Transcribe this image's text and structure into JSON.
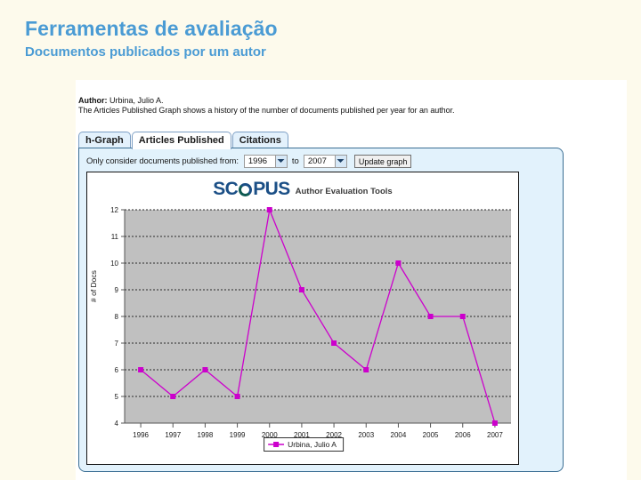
{
  "slide": {
    "title": "Ferramentas de avaliação",
    "subtitle": "Documentos publicados por um autor",
    "title_color": "#4a9bd4"
  },
  "capture": {
    "author_label": "Author:",
    "author_name": "Urbina, Julio A.",
    "description": "The Articles Published Graph shows a history of the number of documents published per year for an author.",
    "tabs": [
      {
        "label": "h-Graph",
        "active": false
      },
      {
        "label": "Articles Published",
        "active": true
      },
      {
        "label": "Citations",
        "active": false
      }
    ],
    "filter": {
      "label": "Only consider documents published from:",
      "from_value": "1996",
      "to_label": "to",
      "to_value": "2007",
      "update_button": "Update graph"
    },
    "logo": {
      "brand_prefix": "SC",
      "brand_suffix": "PUS",
      "tagline": "Author Evaluation Tools",
      "brand_color": "#1b4f86"
    }
  },
  "chart_data": {
    "type": "line",
    "title": "",
    "xlabel": "",
    "ylabel": "# of Docs",
    "categories": [
      "1996",
      "1997",
      "1998",
      "1999",
      "2000",
      "2001",
      "2002",
      "2003",
      "2004",
      "2005",
      "2006",
      "2007"
    ],
    "yticks": [
      12,
      11,
      10,
      9,
      8,
      7,
      6,
      5,
      4
    ],
    "ylim": [
      4,
      12
    ],
    "grid": true,
    "legend_position": "bottom-center",
    "plot_bgcolor": "#c0c0c0",
    "series": [
      {
        "name": "Urbina, Julio A",
        "color": "#cc00cc",
        "values": [
          6,
          5,
          6,
          5,
          12,
          9,
          7,
          6,
          10,
          8,
          8,
          4
        ]
      }
    ]
  }
}
